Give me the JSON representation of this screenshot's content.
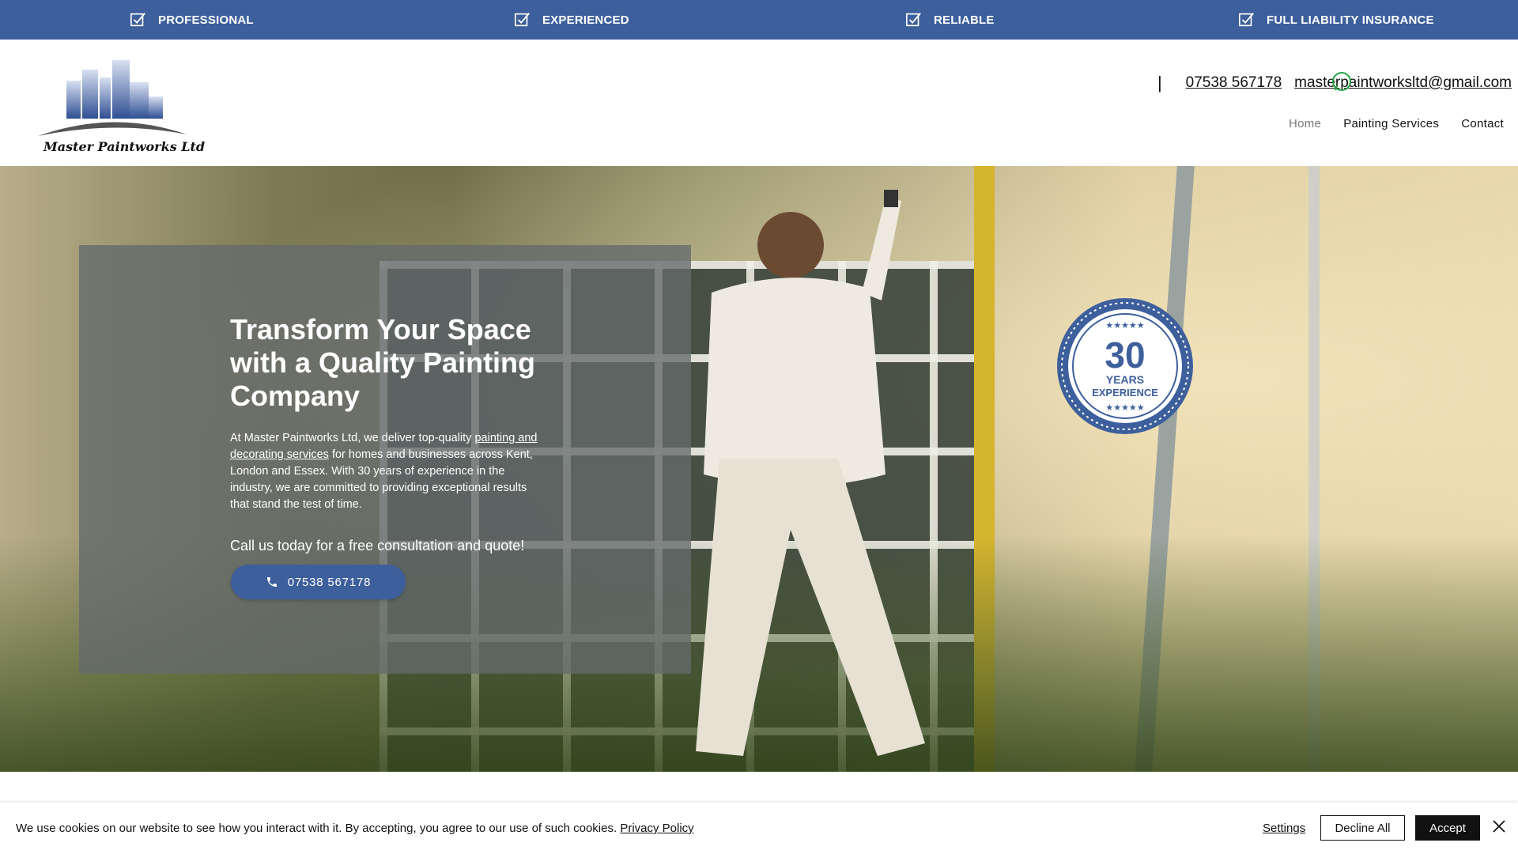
{
  "topbar": {
    "items": [
      {
        "label": "PROFESSIONAL",
        "icon": "checkbox-icon"
      },
      {
        "label": "EXPERIENCED",
        "icon": "checkbox-icon"
      },
      {
        "label": "RELIABLE",
        "icon": "checkbox-icon"
      },
      {
        "label": "FULL LIABILITY INSURANCE",
        "icon": "checkbox-icon"
      }
    ],
    "color": "#3d5f9c"
  },
  "header": {
    "logo_text": "Master Paintworks Ltd",
    "separator": "|",
    "phone": "07538 567178",
    "phone_overlap": "07538",
    "email": "masterpaintworksltd@gmail.com",
    "nav": [
      {
        "label": "Home",
        "active": true
      },
      {
        "label": "Painting Services",
        "active": false
      },
      {
        "label": "Contact",
        "active": false
      }
    ]
  },
  "hero": {
    "title": "Transform Your Space with a Quality Painting Company",
    "text_before": "At Master Paintworks Ltd, we deliver top-quality ",
    "text_link": "painting and decorating services",
    "text_after": " for homes and businesses across Kent, London and Essex. With 30 years of experience in the industry, we are committed to providing exceptional results that stand the test of time.",
    "cta": "Call us today for a free consultation and quote!",
    "button_label": "07538 567178",
    "badge": {
      "number": "30",
      "line1": "YEARS",
      "line2": "EXPERIENCE"
    }
  },
  "cookie": {
    "text": "We use cookies on our website to see how you interact with it. By accepting, you agree to our use of such cookies.",
    "privacy_link": "Privacy Policy",
    "settings": "Settings",
    "decline": "Decline All",
    "accept": "Accept"
  }
}
